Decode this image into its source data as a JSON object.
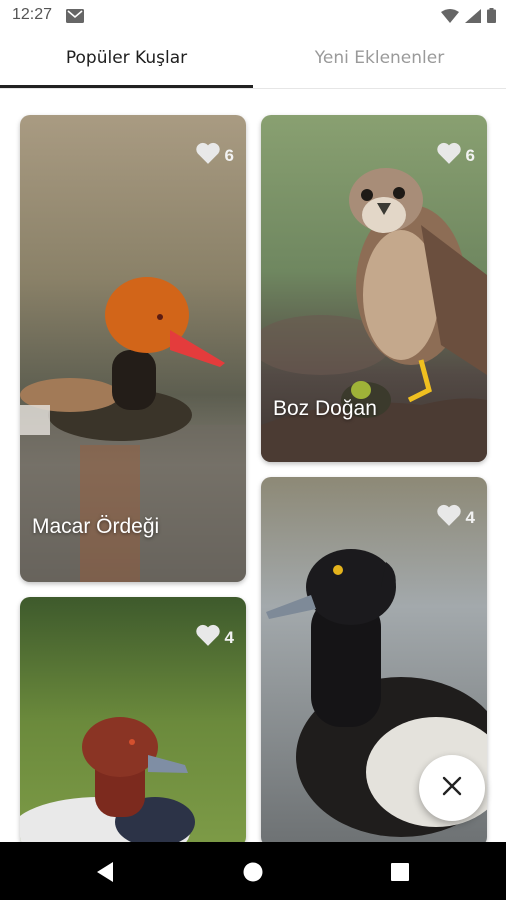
{
  "status_bar": {
    "time": "12:27"
  },
  "tabs": [
    {
      "label": "Popüler Kuşlar",
      "active": true
    },
    {
      "label": "Yeni Eklenenler",
      "active": false
    }
  ],
  "cards": [
    {
      "name": "Macar Ördeği",
      "likes": "6"
    },
    {
      "name": "Boz Doğan",
      "likes": "6"
    },
    {
      "name": "",
      "likes": "4"
    },
    {
      "name": "",
      "likes": "4"
    }
  ],
  "colors": {
    "accent": "#222222",
    "like_icon": "#e0e0e0",
    "inactive_tab": "#9a9a9a"
  },
  "icons": [
    "mail-icon",
    "wifi-icon",
    "signal-icon",
    "battery-icon",
    "heart-icon",
    "close-icon",
    "back-icon",
    "home-icon",
    "recents-icon"
  ]
}
